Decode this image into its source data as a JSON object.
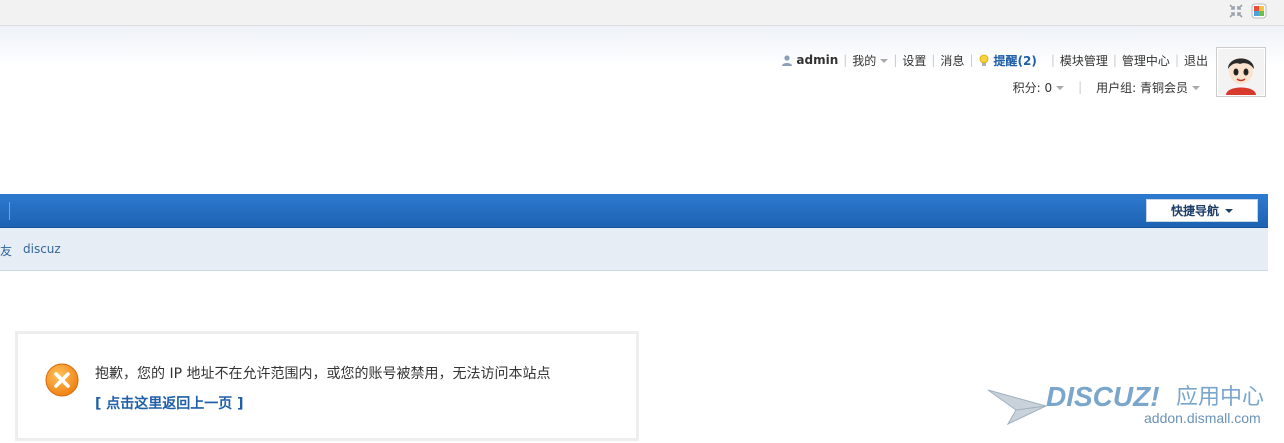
{
  "top_strip": {
    "collapse_icon": "collapse-arrows-icon",
    "theme_icon": "color-palette-icon"
  },
  "user_bar": {
    "user_icon": "user-icon",
    "username": "admin",
    "mine": "我的",
    "settings": "设置",
    "messages": "消息",
    "bulb_icon": "lightbulb-icon",
    "notices": "提醒(2)",
    "module_manage": "模块管理",
    "admin_center": "管理中心",
    "logout": "退出"
  },
  "user_bar2": {
    "credits": "积分: 0",
    "user_group": "用户组: 青铜会员"
  },
  "nav": {
    "quick_nav_label": "快捷导航"
  },
  "subbar": {
    "links": [
      "友",
      "discuz"
    ]
  },
  "message": {
    "icon": "error-x-icon",
    "text": "抱歉，您的 IP 地址不在允许范围内，或您的账号被禁用，无法访问本站点",
    "back_link": "[ 点击这里返回上一页 ]"
  },
  "watermark": {
    "logo_text": "DISCUZ!",
    "logo_cn": "应用中心",
    "domain": "addon.dismall.com"
  },
  "colors": {
    "nav_blue": "#1d62b2",
    "link_blue": "#1f5ea8",
    "error_orange": "#f08a24"
  }
}
